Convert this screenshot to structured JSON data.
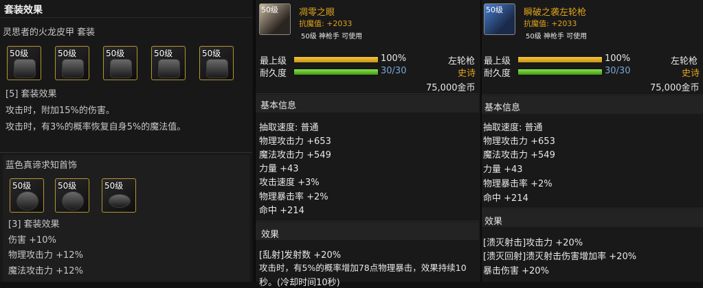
{
  "set_panel": {
    "title": "套装效果",
    "set1": {
      "name": "灵思者的火龙皮甲 套装",
      "pieces": [
        "50级",
        "50级",
        "50级",
        "50级",
        "50级"
      ],
      "bonus_header": "[5] 套装效果",
      "bonus_lines": [
        "攻击时，附加15%的伤害。",
        "攻击时，有3%的概率恢复自身5%的魔法值。"
      ]
    },
    "set2": {
      "name": "蓝色真谛求知首饰",
      "pieces": [
        "50级",
        "50级",
        "50级"
      ],
      "bonus_header": "[3] 套装效果",
      "bonus_lines": [
        "伤害 +10%",
        "物理攻击力 +12%",
        "魔法攻击力 +12%"
      ]
    }
  },
  "item1": {
    "icon_level": "50级",
    "name": "凋零之眼",
    "resist_label": "抗魔值:",
    "resist_value": "+2033",
    "req": "50级 神枪手 可使用",
    "quality_label": "最上级",
    "quality_value": "100%",
    "quality_fill": 1.0,
    "durability_label": "耐久度",
    "durability_value": "30/30",
    "durability_fill": 1.0,
    "type": "左轮枪",
    "rarity": "史诗",
    "price": "75,000金币",
    "basic_header": "基本信息",
    "stats": [
      "抽取速度: 普通",
      "物理攻击力 +653",
      "魔法攻击力 +549",
      "力量 +43",
      "攻击速度 +3%",
      "物理暴击率 +2%",
      "命中 +214"
    ],
    "effect_header": "效果",
    "effects": [
      "[乱射]发射数 +20%",
      "攻击时，有5%的概率增加78点物理暴击，效果持续10",
      "秒。(冷却时间10秒)"
    ]
  },
  "item2": {
    "icon_level": "50级",
    "name": "瞬破之袭左轮枪",
    "resist_label": "抗魔值:",
    "resist_value": "+2033",
    "req": "50级 神枪手 可使用",
    "quality_label": "最上级",
    "quality_value": "100%",
    "quality_fill": 1.0,
    "durability_label": "耐久度",
    "durability_value": "30/30",
    "durability_fill": 1.0,
    "type": "左轮枪",
    "rarity": "史诗",
    "price": "75,000金币",
    "basic_header": "基本信息",
    "stats": [
      "抽取速度: 普通",
      "物理攻击力 +653",
      "魔法攻击力 +549",
      "力量 +43",
      "物理暴击率 +2%",
      "命中 +214"
    ],
    "effect_header": "效果",
    "effects": [
      "[溃灭射击]攻击力 +20%",
      "[溃灭回射]溃灭射击伤害增加率 +20%",
      "暴击伤害 +20%"
    ]
  }
}
